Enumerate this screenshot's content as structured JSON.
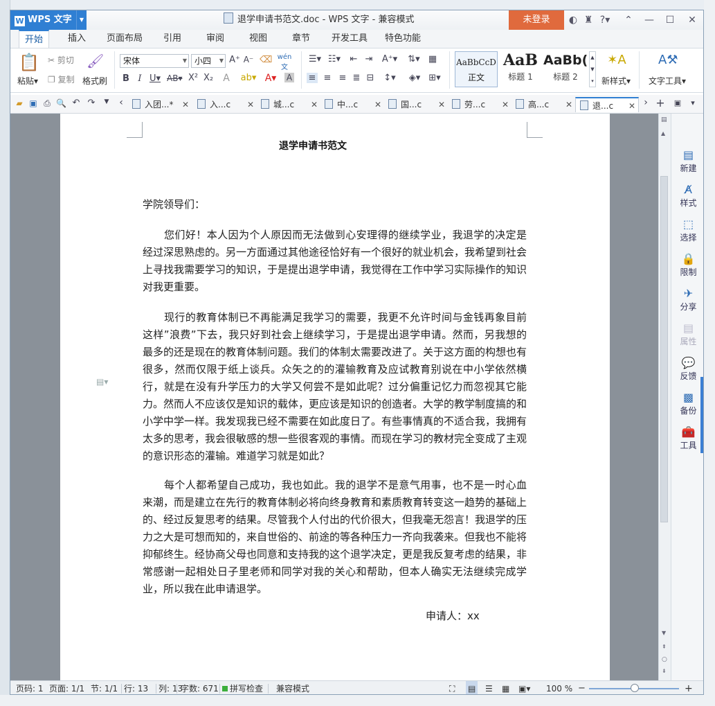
{
  "window": {
    "app_name": "WPS 文字",
    "logo_letter": "W",
    "doc_title": "退学申请书范文.doc - WPS 文字 - 兼容模式",
    "login_label": "未登录"
  },
  "menu_tabs": [
    "开始",
    "插入",
    "页面布局",
    "引用",
    "审阅",
    "视图",
    "章节",
    "开发工具",
    "特色功能"
  ],
  "ribbon": {
    "paste": "粘贴",
    "cut": "剪切",
    "copy": "复制",
    "format_painter": "格式刷",
    "font_name": "宋体",
    "font_size": "小四",
    "styles": [
      {
        "preview": "AaBbCcD",
        "label": "正文"
      },
      {
        "preview": "AaB",
        "label": "标题 1"
      },
      {
        "preview": "AaBb(",
        "label": "标题 2"
      }
    ],
    "new_style": "新样式",
    "text_tools": "文字工具"
  },
  "doc_tabs": [
    "入团...*",
    "入...c",
    "城...c",
    "中...c",
    "国...c",
    "劳...c",
    "高...c",
    "退...c"
  ],
  "document": {
    "heading": "退学申请书范文",
    "salutation": "学院领导们：",
    "paragraphs": [
      "您们好！本人因为个人原因而无法做到心安理得的继续学业，我退学的决定是经过深思熟虑的。另一方面通过其他途径恰好有一个很好的就业机会，我希望到社会上寻找我需要学习的知识，于是提出退学申请，我觉得在工作中学习实际操作的知识对我更重要。",
      "现行的教育体制已不再能满足我学习的需要，我更不允许时间与金钱再象目前这样”浪费”下去，我只好到社会上继续学习，于是提出退学申请。然而，另我想的最多的还是现在的教育体制问题。我们的体制太需要改进了。关于这方面的构想也有很多，然而仅限于纸上谈兵。众矢之的的灌输教育及应试教育别说在中小学依然横行，就是在没有升学压力的大学又何尝不是如此呢？过分偏重记忆力而忽视其它能力。然而人不应该仅是知识的载体，更应该是知识的创造者。大学的教学制度搞的和小学中学一样。我发现我已经不需要在如此度日了。有些事情真的不适合我，我拥有太多的思考，我会很敏感的想一些很客观的事情。而现在学习的教材完全变成了主观的意识形态的灌输。难道学习就是如此？",
      "每个人都希望自己成功，我也如此。我的退学不是意气用事，也不是一时心血来潮，而是建立在先行的教育体制必将向终身教育和素质教育转变这一趋势的基础上的、经过反复思考的结果。尽管我个人付出的代价很大，但我毫无怨言！我退学的压力之大是可想而知的，来自世俗的、前途的等各种压力一齐向我袭来。但我也不能将抑郁终生。经协商父母也同意和支持我的这个退学决定，更是我反复考虑的结果，非常感谢一起相处日子里老师和同学对我的关心和帮助，但本人确实无法继续完成学业，所以我在此申请退学。"
    ],
    "signature": "申请人：xx"
  },
  "task_pane": [
    "新建",
    "样式",
    "选择",
    "限制",
    "分享",
    "属性",
    "反馈",
    "备份",
    "工具"
  ],
  "status": {
    "page_code": "页码: 1",
    "pages": "页面: 1/1",
    "section": "节: 1/1",
    "row": "行: 13",
    "col": "列: 13",
    "word_count": "字数: 671",
    "spell_check": "拼写检查",
    "compat_mode": "兼容模式",
    "zoom": "100 %"
  },
  "colors": {
    "accent": "#2f7fd3",
    "login": "#e06a3d",
    "doc_background": "#8a9199"
  }
}
